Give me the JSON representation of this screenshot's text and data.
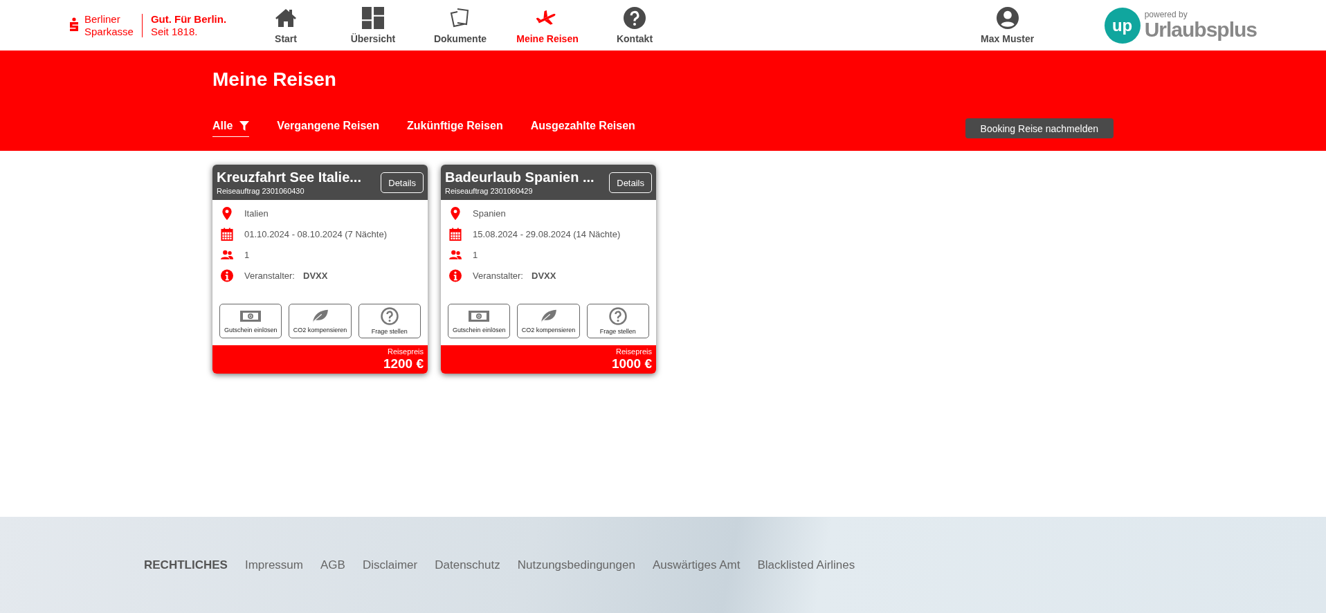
{
  "brand": {
    "name_lines": [
      "Berliner",
      "Sparkasse"
    ],
    "slogan_lines": [
      "Gut. Für Berlin.",
      "Seit 1818."
    ]
  },
  "nav": [
    {
      "label": "Start",
      "kind": "home",
      "selected": false
    },
    {
      "label": "Übersicht",
      "kind": "overview",
      "selected": false
    },
    {
      "label": "Dokumente",
      "kind": "documents",
      "selected": false
    },
    {
      "label": "Meine Reisen",
      "kind": "trips",
      "selected": true
    },
    {
      "label": "Kontakt",
      "kind": "contact",
      "selected": false
    }
  ],
  "user": {
    "name": "Max Muster"
  },
  "partner": {
    "tagline": "powered by",
    "badge": "up",
    "name": "Urlaubsplus"
  },
  "page": {
    "title": "Meine Reisen"
  },
  "tabs": [
    {
      "label": "Alle",
      "selected": true,
      "filter": true
    },
    {
      "label": "Vergangene Reisen",
      "selected": false,
      "filter": false
    },
    {
      "label": "Zukünftige Reisen",
      "selected": false,
      "filter": false
    },
    {
      "label": "Ausgezahlte Reisen",
      "selected": false,
      "filter": false
    }
  ],
  "report_button": "Booking Reise nachmelden",
  "trips": [
    {
      "title": "Kreuzfahrt See Italie...",
      "order": "Reiseauftrag 2301060430",
      "details": "Details",
      "location": "Italien",
      "dates": "01.10.2024 - 08.10.2024 (7 Nächte)",
      "travelers": "1",
      "organizer_label": "Veranstalter:",
      "organizer": "DVXX",
      "actions": [
        {
          "label": "Gutschein einlösen",
          "kind": "voucher"
        },
        {
          "label": "CO2 kompensieren",
          "kind": "leaf"
        },
        {
          "label": "Frage stellen",
          "kind": "question"
        }
      ],
      "price_label": "Reisepreis",
      "price": "1200 €"
    },
    {
      "title": "Badeurlaub Spanien ...",
      "order": "Reiseauftrag 2301060429",
      "details": "Details",
      "location": "Spanien",
      "dates": "15.08.2024 - 29.08.2024 (14 Nächte)",
      "travelers": "1",
      "organizer_label": "Veranstalter:",
      "organizer": "DVXX",
      "actions": [
        {
          "label": "Gutschein einlösen",
          "kind": "voucher"
        },
        {
          "label": "CO2 kompensieren",
          "kind": "leaf"
        },
        {
          "label": "Frage stellen",
          "kind": "question"
        }
      ],
      "price_label": "Reisepreis",
      "price": "1000 €"
    }
  ],
  "footer": {
    "heading": "RECHTLICHES",
    "links": [
      "Impressum",
      "AGB",
      "Disclaimer",
      "Datenschutz",
      "Nutzungsbedingungen",
      "Auswärtiges Amt",
      "Blacklisted Airlines"
    ]
  }
}
